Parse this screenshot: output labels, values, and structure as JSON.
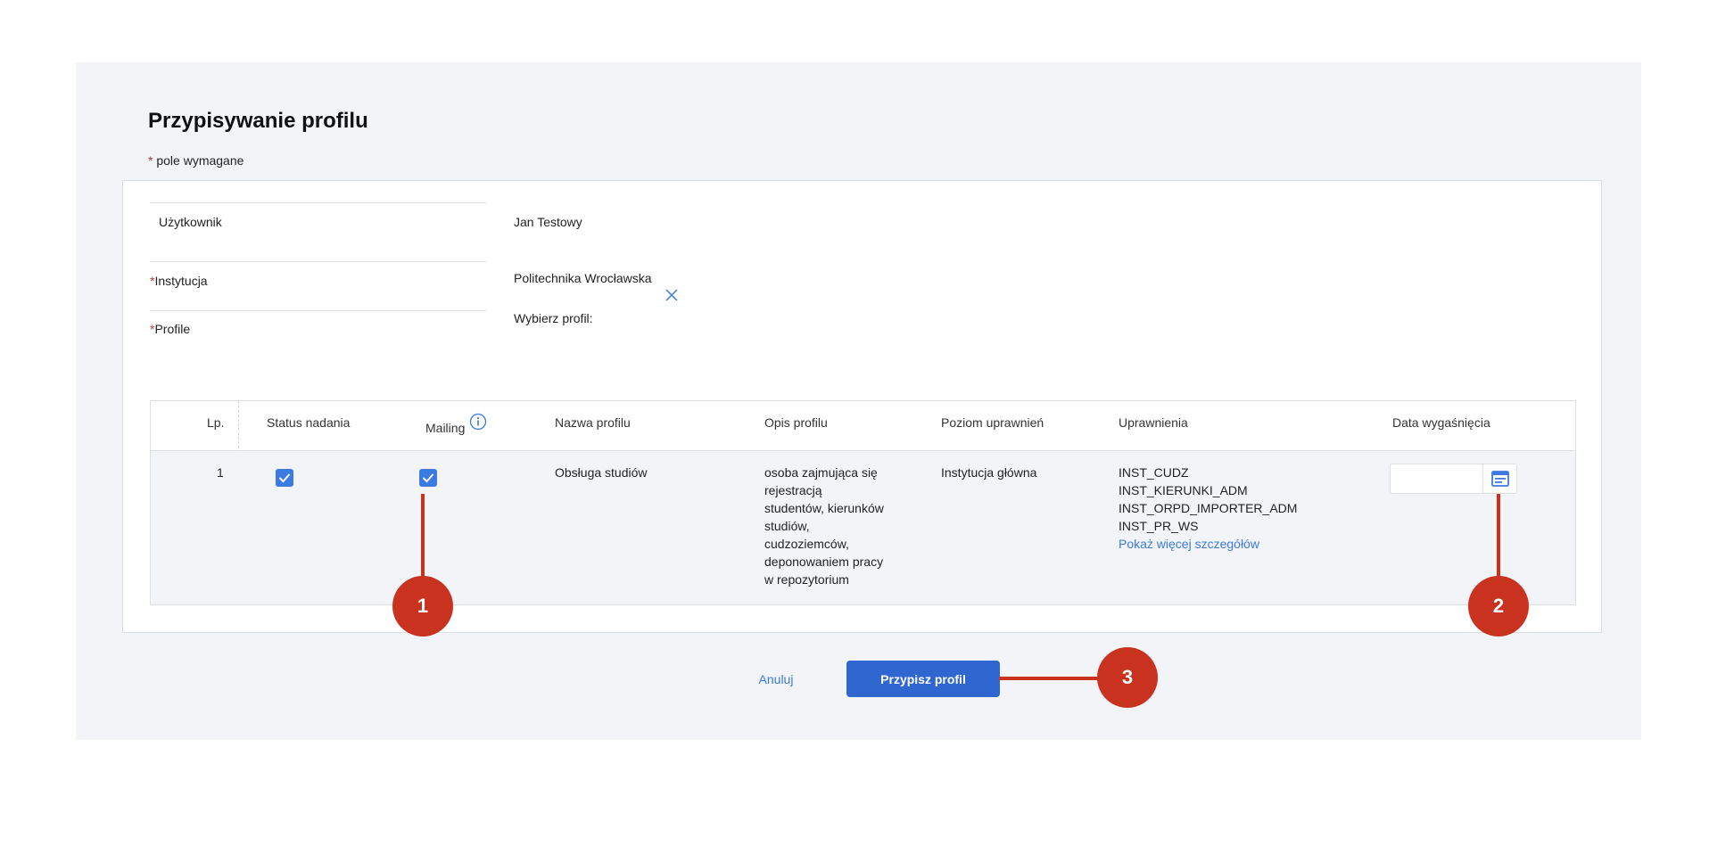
{
  "page": {
    "title": "Przypisywanie profilu",
    "required_mark": "*",
    "required_note": "pole wymagane"
  },
  "form": {
    "user_label": "Użytkownik",
    "user_value": "Jan Testowy",
    "institution_label": "Instytucja",
    "institution_value": "Politechnika Wrocławska",
    "profile_label": "Profile",
    "profile_prompt": "Wybierz profil:"
  },
  "table": {
    "headers": {
      "lp": "Lp.",
      "status": "Status nadania",
      "mailing": "Mailing",
      "name": "Nazwa profilu",
      "description": "Opis profilu",
      "level": "Poziom uprawnień",
      "permissions": "Uprawnienia",
      "expiry": "Data wygaśnięcia"
    },
    "rows": [
      {
        "lp": "1",
        "status_checked": true,
        "mailing_checked": true,
        "name": "Obsługa studiów",
        "description_lines": [
          "osoba zajmująca się",
          "rejestracją",
          "studentów, kierunków",
          "studiów,",
          "cudzoziemców,",
          "deponowaniem pracy",
          "w repozytorium"
        ],
        "level": "Instytucja główna",
        "permissions": [
          "INST_CUDZ",
          "INST_KIERUNKI_ADM",
          "INST_ORPD_IMPORTER_ADM",
          "INST_PR_WS"
        ],
        "more_link": "Pokaż więcej szczegółów",
        "expiry_value": ""
      }
    ]
  },
  "actions": {
    "cancel_label": "Anuluj",
    "submit_label": "Przypisz profil"
  },
  "markers": [
    "1",
    "2",
    "3"
  ],
  "colors": {
    "accent": "#2f66d0",
    "checkbox": "#3b7ae0",
    "marker": "#c9321e",
    "panel_bg": "#f2f4f8"
  }
}
